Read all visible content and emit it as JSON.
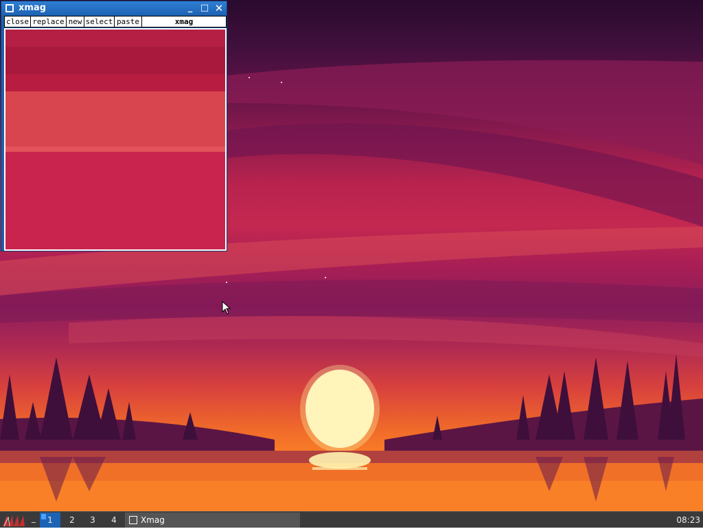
{
  "window": {
    "title": "xmag",
    "minimize_glyph": "_",
    "maximize_glyph": "□",
    "close_glyph": "✕",
    "menu": {
      "close": "close",
      "replace": "replace",
      "new": "new",
      "select": "select",
      "paste": "paste",
      "title": "xmag"
    }
  },
  "taskbar": {
    "minimize_all": "_",
    "workspaces": [
      "1",
      "2",
      "3",
      "4"
    ],
    "active_workspace": "1",
    "task_label": "Xmag",
    "clock": "08:23"
  },
  "colors": {
    "titlebar": "#1d63b4",
    "taskbar": "#3a3a3a",
    "active_workspace": "#1d63b4"
  },
  "icons": {
    "window_icon": "window-icon",
    "start": "start-menu-logo-icon",
    "cursor": "mouse-pointer-icon"
  }
}
